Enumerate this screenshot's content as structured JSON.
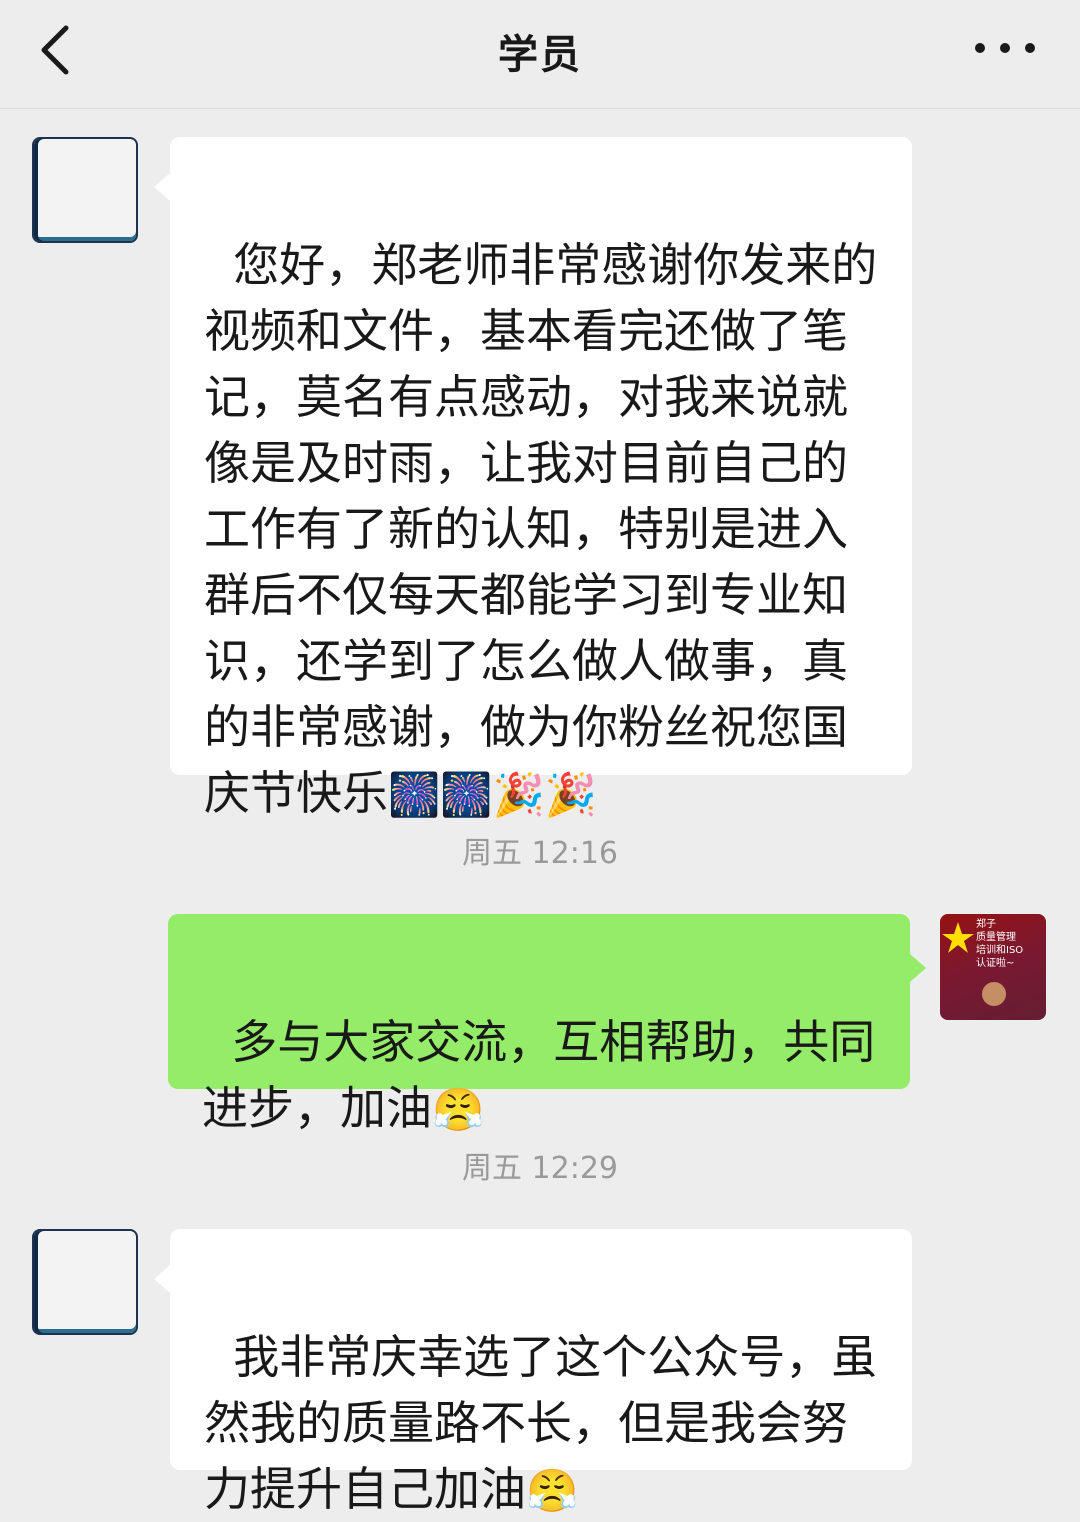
{
  "header": {
    "title": "学员",
    "back_icon": "chevron-left-icon",
    "more_icon": "more-dots-icon"
  },
  "messages": [
    {
      "side": "in",
      "text": "您好，郑老师非常感谢你发来的视频和文件，基本看完还做了笔记，莫名有点感动，对我来说就像是及时雨，让我对目前自己的工作有了新的认知，特别是进入群后不仅每天都能学习到专业知识，还学到了怎么做人做事，真的非常感谢，做为你粉丝祝您国庆节快乐",
      "emoji": "🎆🎆🎉🎉"
    },
    {
      "side": "out",
      "text": "多与大家交流，互相帮助，共同进步，加油",
      "emoji": "😤",
      "avatar_text": "郑子\n质量管理\n培训和ISO\n认证啦~"
    },
    {
      "side": "in",
      "text": "我非常庆幸选了这个公众号，虽然我的质量路不长，但是我会努力提升自己加油",
      "emoji": "😤"
    }
  ],
  "timestamps": [
    "周五 12:16",
    "周五 12:29"
  ],
  "colors": {
    "background": "#ededed",
    "incoming_bubble": "#ffffff",
    "outgoing_bubble": "#95ec69",
    "timestamp_text": "#9a9a9a"
  }
}
